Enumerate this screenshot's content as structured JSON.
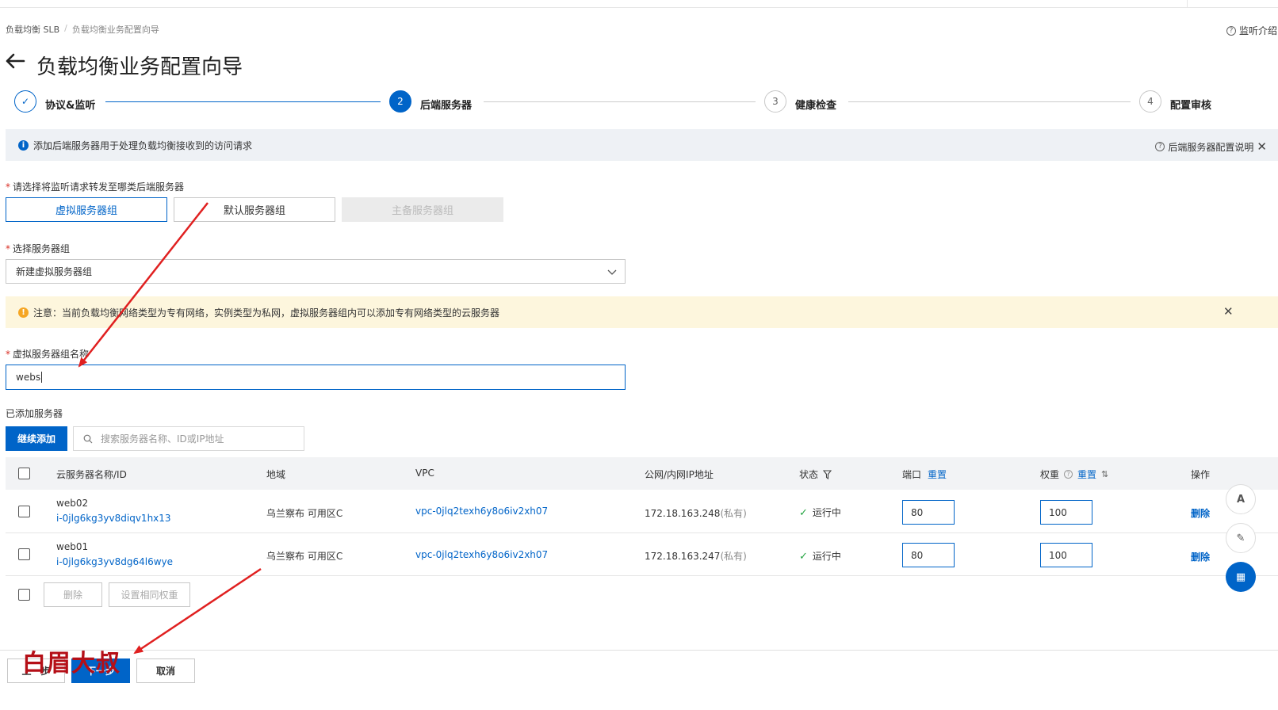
{
  "breadcrumb": {
    "root": "负载均衡 SLB",
    "sep": "/",
    "current": "负载均衡业务配置向导"
  },
  "help_link": {
    "label": "监听介绍",
    "icon": "question-circle-icon"
  },
  "page_title": "负载均衡业务配置向导",
  "steps": [
    {
      "index": "✓",
      "label": "协议&监听",
      "state": "done"
    },
    {
      "index": "2",
      "label": "后端服务器",
      "state": "active"
    },
    {
      "index": "3",
      "label": "健康检查",
      "state": "todo"
    },
    {
      "index": "4",
      "label": "配置审核",
      "state": "todo"
    }
  ],
  "info_bar": {
    "text": "添加后端服务器用于处理负载均衡接收到的访问请求",
    "right_link": "后端服务器配置说明"
  },
  "forward_question": {
    "required": "*",
    "label": "请选择将监听请求转发至哪类后端服务器"
  },
  "server_types": [
    {
      "label": "虚拟服务器组",
      "state": "selected"
    },
    {
      "label": "默认服务器组",
      "state": "normal"
    },
    {
      "label": "主备服务器组",
      "state": "disabled"
    }
  ],
  "group_select": {
    "required": "*",
    "label": "选择服务器组",
    "value": "新建虚拟服务器组"
  },
  "warning_bar": {
    "text": "注意：当前负载均衡网络类型为专有网络，实例类型为私网，虚拟服务器组内可以添加专有网络类型的云服务器"
  },
  "group_name": {
    "required": "*",
    "label": "虚拟服务器组名称",
    "value": "webs"
  },
  "added_servers_label": "已添加服务器",
  "continue_add_button": "继续添加",
  "search": {
    "placeholder": "搜索服务器名称、ID或IP地址"
  },
  "table": {
    "headers": {
      "name": "云服务器名称/ID",
      "region": "地域",
      "vpc": "VPC",
      "ip": "公网/内网IP地址",
      "status": "状态",
      "port": "端口",
      "port_reset": "重置",
      "weight": "权重",
      "weight_reset": "重置",
      "ops": "操作"
    },
    "rows": [
      {
        "name": "web02",
        "id": "i-0jlg6kg3yv8diqv1hx13",
        "region": "乌兰察布 可用区C",
        "vpc": "vpc-0jlq2texh6y8o6iv2xh07",
        "ip": "172.18.163.248",
        "ip_type": "(私有)",
        "status": "运行中",
        "port": "80",
        "weight": "100",
        "action": "删除"
      },
      {
        "name": "web01",
        "id": "i-0jlg6kg3yv8dg64l6wye",
        "region": "乌兰察布 可用区C",
        "vpc": "vpc-0jlq2texh6y8o6iv2xh07",
        "ip": "172.18.163.247",
        "ip_type": "(私有)",
        "status": "运行中",
        "port": "80",
        "weight": "100",
        "action": "删除"
      }
    ]
  },
  "batch": {
    "delete": "删除",
    "set_weight": "设置相同权重"
  },
  "footer": {
    "prev": "上一步",
    "next": "下一步",
    "cancel": "取消"
  },
  "watermark": "白眉大叔",
  "colors": {
    "primary": "#0064c8",
    "warning_bg": "#fdf6dd",
    "info_bg": "#eef1f5",
    "success": "#27a544",
    "annotation": "#e02020"
  }
}
